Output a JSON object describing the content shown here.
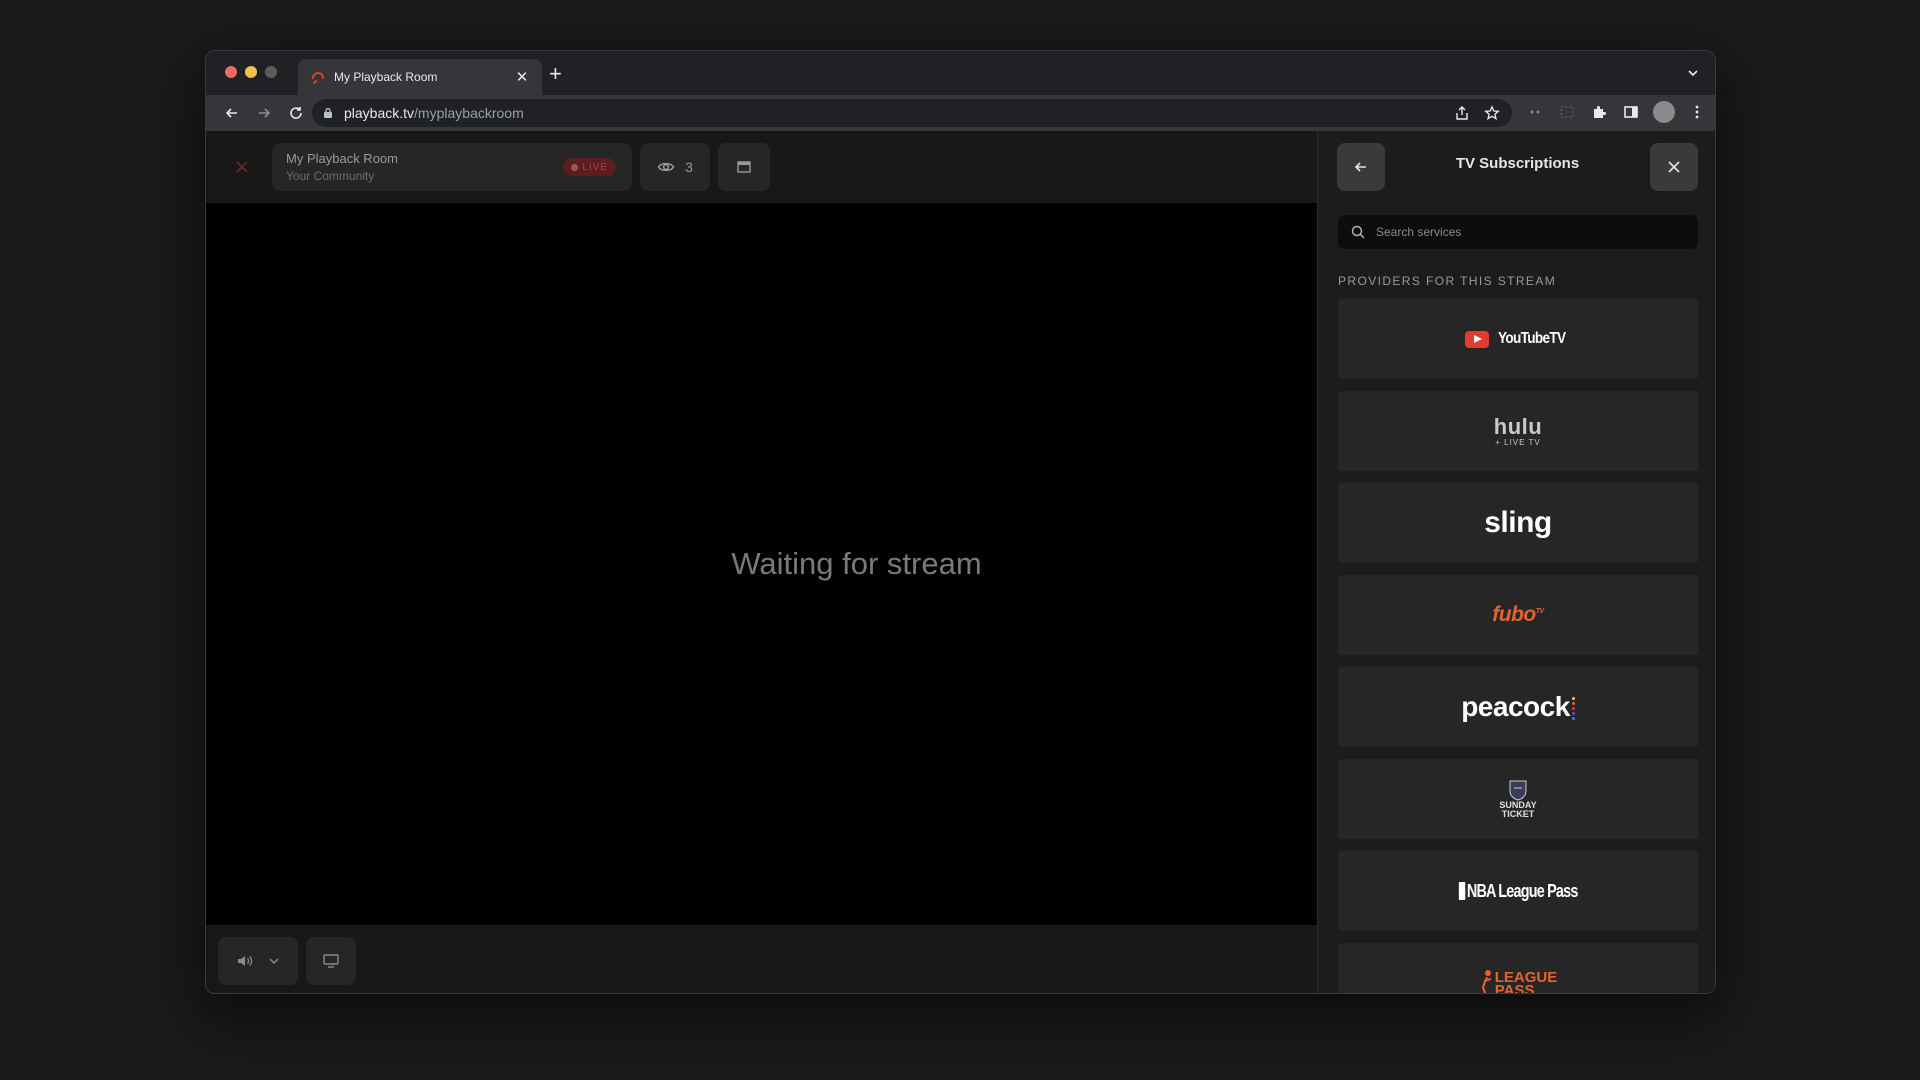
{
  "browser": {
    "tab_title": "My Playback Room",
    "url_host": "playback.tv",
    "url_path": "/myplaybackroom"
  },
  "room": {
    "name": "My Playback Room",
    "community": "Your Community",
    "live_label": "LIVE",
    "viewer_count": "3"
  },
  "player": {
    "waiting_text": "Waiting for stream"
  },
  "panel": {
    "title": "TV Subscriptions",
    "search_placeholder": "Search services",
    "section_label": "PROVIDERS FOR THIS STREAM",
    "providers": [
      {
        "name": "YouTubeTV"
      },
      {
        "name": "hulu",
        "sub": "+ LIVE TV"
      },
      {
        "name": "sling"
      },
      {
        "name": "fubo",
        "sup": "TV"
      },
      {
        "name": "peacock"
      },
      {
        "name": "SUNDAY",
        "sub": "TICKET"
      },
      {
        "name": "NBA League Pass"
      },
      {
        "name": "LEAGUE",
        "sub": "PASS"
      }
    ]
  },
  "colors": {
    "accent_red": "#e43a2f",
    "fubo_orange": "#e8632b",
    "background": "#141414"
  },
  "icons": [
    "close-icon",
    "eye-icon",
    "window-icon",
    "volume-icon",
    "chevron-down-icon",
    "screen-icon",
    "arrow-left-icon",
    "search-icon",
    "lock-icon",
    "star-icon",
    "share-icon",
    "puzzle-icon",
    "sidebar-icon",
    "kebab-menu-icon"
  ]
}
